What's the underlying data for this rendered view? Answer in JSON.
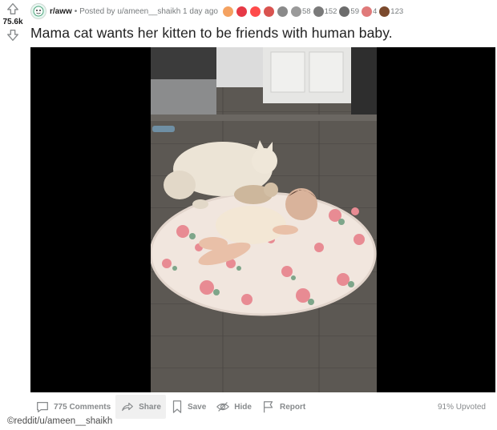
{
  "post": {
    "subreddit": "r/aww",
    "posted_by": "• Posted by u/ameen__shaikh 1 day ago",
    "score": "75.6k",
    "title": "Mama cat wants her kitten to be friends with human baby.",
    "awards": [
      {
        "icon": "award-1-icon",
        "color": "#f4a261",
        "count": ""
      },
      {
        "icon": "award-2-icon",
        "color": "#e63946",
        "count": ""
      },
      {
        "icon": "heart-award-icon",
        "color": "#ff4b4b",
        "count": ""
      },
      {
        "icon": "award-4-icon",
        "color": "#d9534f",
        "count": ""
      },
      {
        "icon": "award-5-icon",
        "color": "#8a8a8a",
        "count": ""
      },
      {
        "icon": "award-6-icon",
        "color": "#9a9a9a",
        "count": "58"
      },
      {
        "icon": "award-7-icon",
        "color": "#7a7a7a",
        "count": "152"
      },
      {
        "icon": "award-8-icon",
        "color": "#6c6c6c",
        "count": "59"
      },
      {
        "icon": "award-9-icon",
        "color": "#e07a7a",
        "count": "4"
      },
      {
        "icon": "award-10-icon",
        "color": "#7b4a2d",
        "count": "123"
      }
    ]
  },
  "actions": {
    "comments": "775 Comments",
    "share": "Share",
    "save": "Save",
    "hide": "Hide",
    "report": "Report",
    "upvoted": "91% Upvoted"
  },
  "watermark": "©reddit/u/ameen__shaikh",
  "colors": {
    "meta_text": "#787c7e",
    "action_text": "#878a8c",
    "share_bg": "#f0f0f0"
  }
}
